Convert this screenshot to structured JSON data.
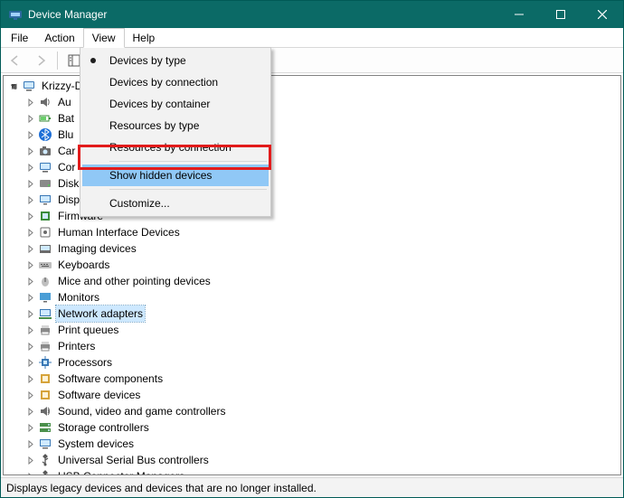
{
  "window": {
    "title": "Device Manager"
  },
  "menubar": {
    "file": "File",
    "action": "Action",
    "view": "View",
    "help": "Help"
  },
  "view_menu": {
    "items": {
      "by_type": "Devices by type",
      "by_connection": "Devices by connection",
      "by_container": "Devices by container",
      "res_by_type": "Resources by type",
      "res_by_conn": "Resources by connection",
      "show_hidden": "Show hidden devices",
      "customize": "Customize..."
    },
    "selected": "by_type",
    "highlighted": "show_hidden"
  },
  "tree": {
    "root": "Krizzy-D",
    "selected": "Network adapters",
    "nodes": [
      {
        "label": "Au",
        "truncated": true,
        "icon": "audio"
      },
      {
        "label": "Bat",
        "truncated": true,
        "icon": "battery"
      },
      {
        "label": "Blu",
        "truncated": true,
        "icon": "bluetooth"
      },
      {
        "label": "Car",
        "truncated": true,
        "icon": "camera"
      },
      {
        "label": "Cor",
        "truncated": true,
        "icon": "computer"
      },
      {
        "label": "Disk",
        "truncated": true,
        "icon": "disk"
      },
      {
        "label": "Disp",
        "truncated": true,
        "icon": "display"
      },
      {
        "label": "Firmware",
        "icon": "firmware"
      },
      {
        "label": "Human Interface Devices",
        "icon": "hid"
      },
      {
        "label": "Imaging devices",
        "icon": "imaging"
      },
      {
        "label": "Keyboards",
        "icon": "keyboard"
      },
      {
        "label": "Mice and other pointing devices",
        "icon": "mouse"
      },
      {
        "label": "Monitors",
        "icon": "monitor"
      },
      {
        "label": "Network adapters",
        "icon": "network"
      },
      {
        "label": "Print queues",
        "icon": "printer"
      },
      {
        "label": "Printers",
        "icon": "printer"
      },
      {
        "label": "Processors",
        "icon": "cpu"
      },
      {
        "label": "Software components",
        "icon": "software"
      },
      {
        "label": "Software devices",
        "icon": "software"
      },
      {
        "label": "Sound, video and game controllers",
        "icon": "sound"
      },
      {
        "label": "Storage controllers",
        "icon": "storage"
      },
      {
        "label": "System devices",
        "icon": "system"
      },
      {
        "label": "Universal Serial Bus controllers",
        "icon": "usb"
      },
      {
        "label": "USB Connector Managers",
        "icon": "usb"
      }
    ]
  },
  "statusbar": {
    "text": "Displays legacy devices and devices that are no longer installed."
  }
}
